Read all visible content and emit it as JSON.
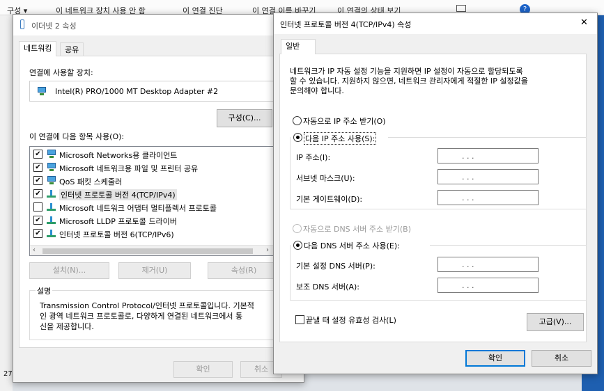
{
  "background": {
    "toolbar_items": [
      "구성 ▾",
      "이 네트워크 장치 사용 안 함",
      "이 연결 진단",
      "이 연결 이름 바꾸기",
      "이 연결의 상태 보기"
    ],
    "help_label": "?",
    "left_count": "27"
  },
  "ethernet_dialog": {
    "title": "이더넷 2 속성",
    "tabs": [
      "네트워킹",
      "공유"
    ],
    "connect_using_label": "연결에 사용할 장치:",
    "adapter_name": "Intel(R) PRO/1000 MT Desktop Adapter #2",
    "configure_button": "구성(C)...",
    "items_label": "이 연결에 다음 항목 사용(O):",
    "items": [
      {
        "label": "Microsoft Networks용 클라이언트",
        "checked": true,
        "icon": "network-client-icon"
      },
      {
        "label": "Microsoft 네트워크용 파일 및 프린터 공유",
        "checked": true,
        "icon": "file-printer-share-icon"
      },
      {
        "label": "QoS 패킷 스케줄러",
        "checked": true,
        "icon": "qos-icon"
      },
      {
        "label": "인터넷 프로토콜 버전 4(TCP/IPv4)",
        "checked": true,
        "icon": "protocol-icon"
      },
      {
        "label": "Microsoft 네트워크 어댑터 멀티플렉서 프로토콜",
        "checked": false,
        "icon": "protocol-icon"
      },
      {
        "label": "Microsoft LLDP 프로토콜 드라이버",
        "checked": true,
        "icon": "protocol-icon"
      },
      {
        "label": "인터넷 프로토콜 버전 6(TCP/IPv6)",
        "checked": true,
        "icon": "protocol-icon"
      }
    ],
    "install_button": "설치(N)...",
    "remove_button": "제거(U)",
    "properties_button": "속성(R)",
    "description_label": "설명",
    "description_text": [
      "Transmission Control Protocol/인터넷 프로토콜입니다. 기본적",
      "인 광역 네트워크 프로토콜로, 다양하게 연결된 네트워크에서 통",
      "신을 제공합니다."
    ],
    "ok_button": "확인",
    "cancel_button": "취소"
  },
  "ipv4_dialog": {
    "title": "인터넷 프로토콜 버전 4(TCP/IPv4) 속성",
    "tab": "일반",
    "intro": [
      "네트워크가 IP 자동 설정 기능을 지원하면 IP 설정이 자동으로 할당되도록",
      "할 수 있습니다. 지원하지 않으면, 네트워크 관리자에게 적절한 IP 설정값을",
      "문의해야 합니다."
    ],
    "auto_ip": "자동으로 IP 주소 받기(O)",
    "manual_ip": "다음 IP 주소 사용(S):",
    "ip_address_label": "IP 주소(I):",
    "subnet_label": "서브넷 마스크(U):",
    "gateway_label": "기본 게이트웨이(D):",
    "auto_dns": "자동으로 DNS 서버 주소 받기(B)",
    "manual_dns": "다음 DNS 서버 주소 사용(E):",
    "preferred_dns_label": "기본 설정 DNS 서버(P):",
    "alternate_dns_label": "보조 DNS 서버(A):",
    "ip_placeholder": ".       .       .",
    "validate_label": "끝낼 때 설정 유효성 검사(L)",
    "advanced_button": "고급(V)...",
    "ok_button": "확인",
    "cancel_button": "취소",
    "close_glyph": "✕",
    "selected": {
      "ip": "manual",
      "dns": "manual"
    },
    "validate_checked": false
  }
}
